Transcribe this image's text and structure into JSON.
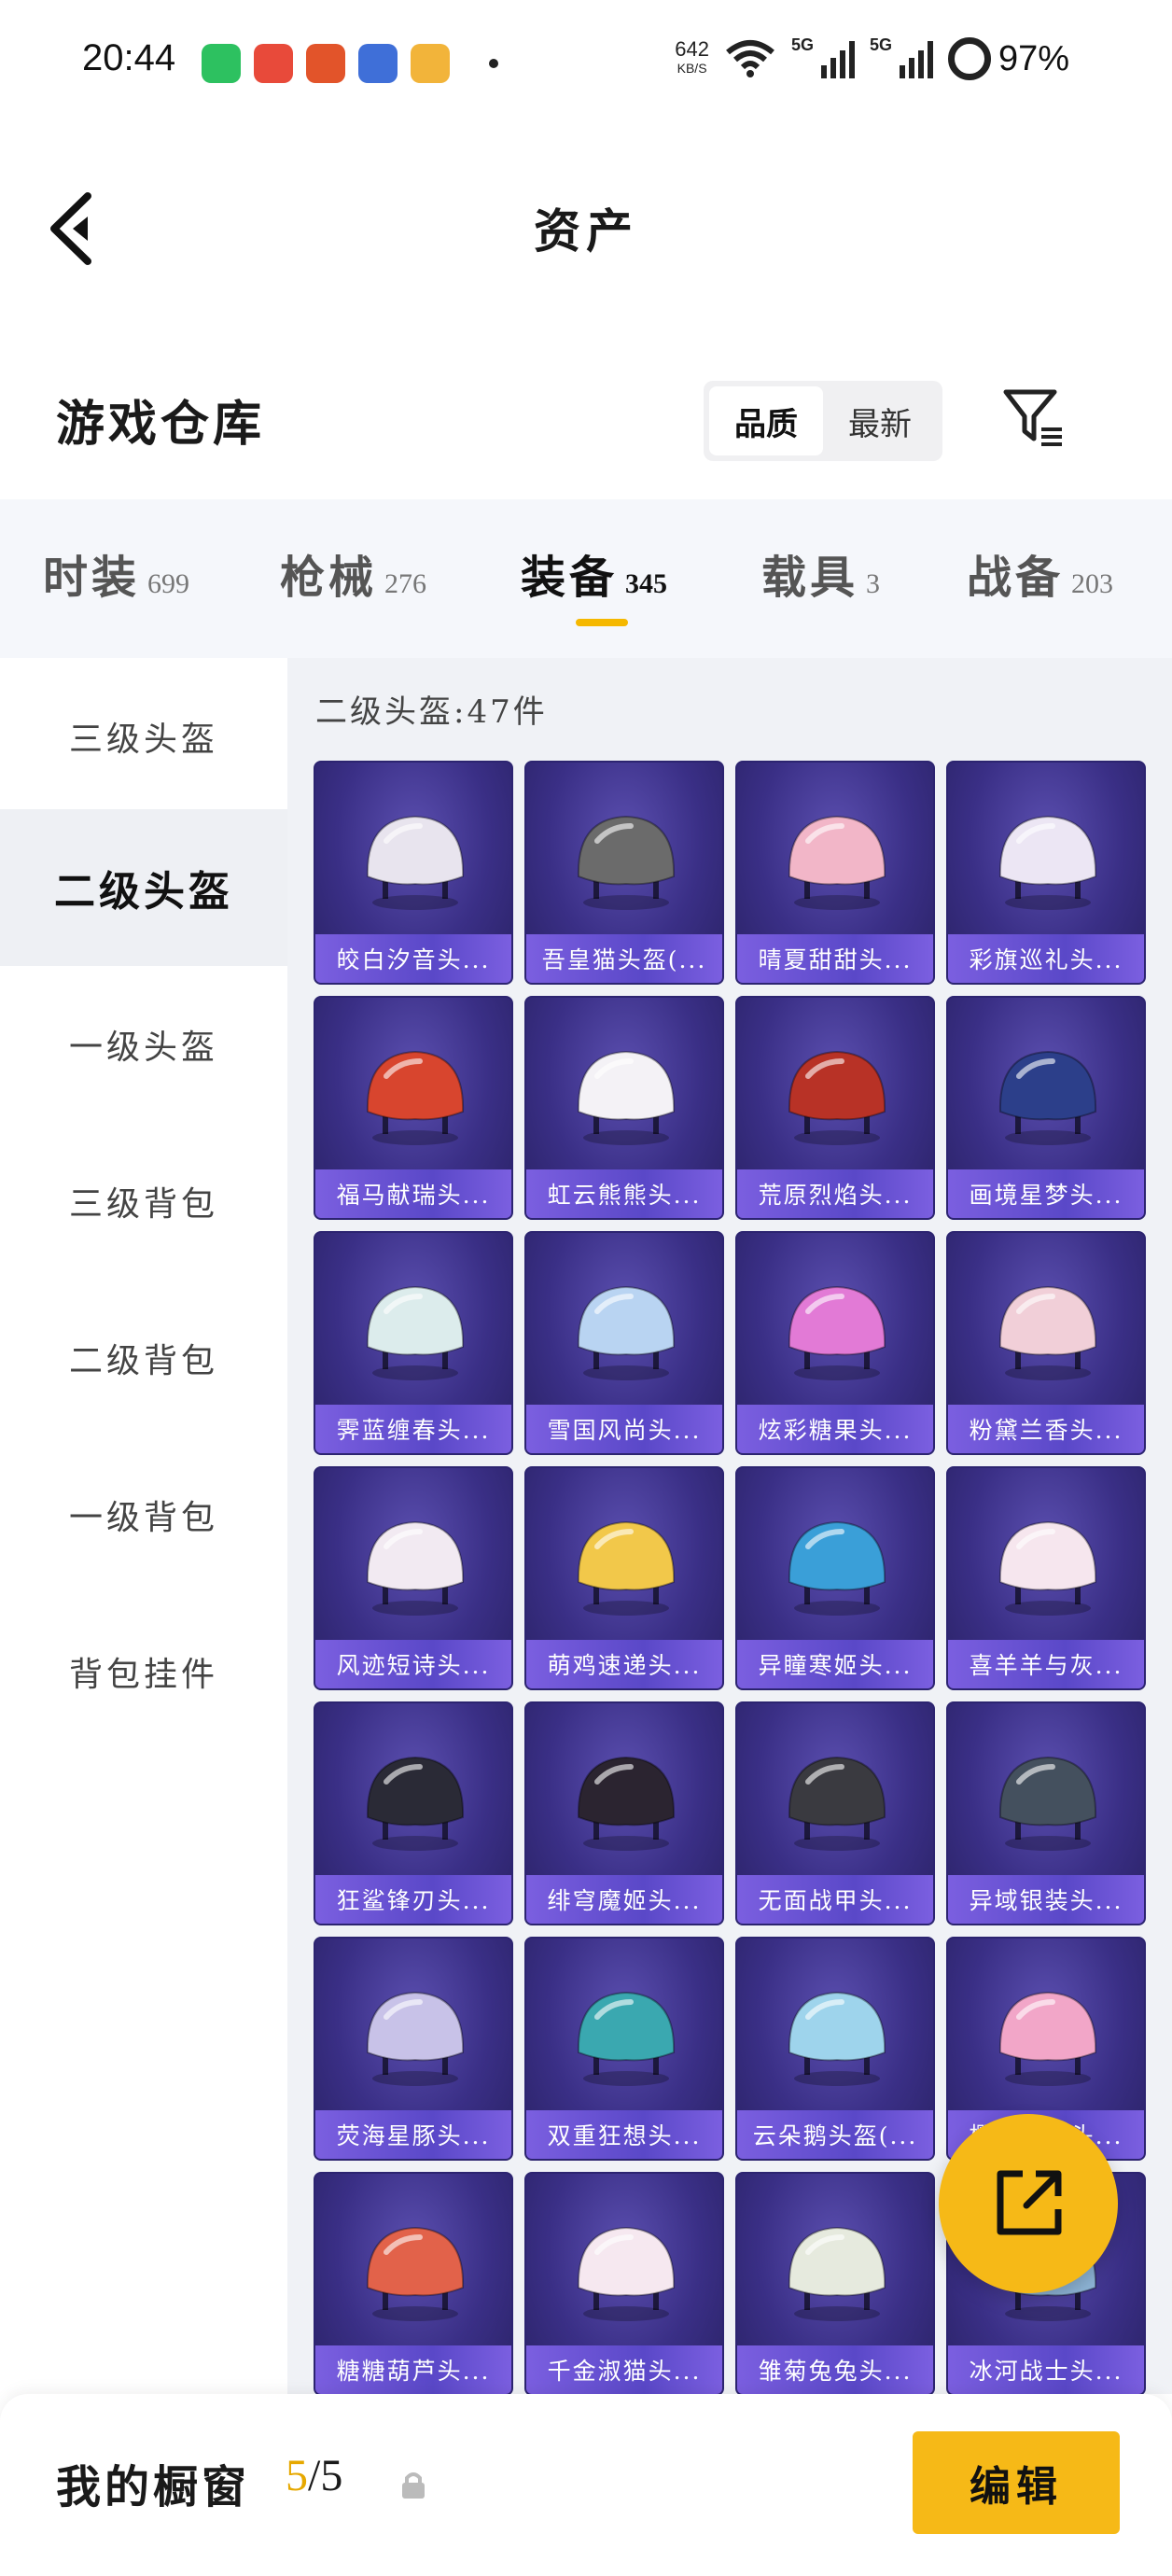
{
  "status_bar": {
    "time": "20:44",
    "net_speed": "642",
    "net_unit": "KB/S",
    "signal_1_label": "5G",
    "signal_2_label": "5G",
    "battery": "97%"
  },
  "header": {
    "title": "资产"
  },
  "warehouse": {
    "title": "游戏仓库",
    "sort_options": [
      "品质",
      "最新"
    ],
    "sort_selected": "品质"
  },
  "tabs": [
    {
      "name": "时装",
      "count": "699"
    },
    {
      "name": "枪械",
      "count": "276"
    },
    {
      "name": "装备",
      "count": "345"
    },
    {
      "name": "载具",
      "count": "3"
    },
    {
      "name": "战备",
      "count": "203"
    }
  ],
  "active_tab": "装备",
  "sidebar": {
    "items": [
      {
        "label": "三级头盔"
      },
      {
        "label": "二级头盔"
      },
      {
        "label": "一级头盔"
      },
      {
        "label": "三级背包"
      },
      {
        "label": "二级背包"
      },
      {
        "label": "一级背包"
      },
      {
        "label": "背包挂件"
      }
    ],
    "active": "二级头盔"
  },
  "content": {
    "count_label": "二级头盔:47件",
    "items": [
      {
        "name": "皎白汐音头...",
        "color": "#e8e4ee"
      },
      {
        "name": "吾皇猫头盔(...",
        "color": "#6b6b6b"
      },
      {
        "name": "晴夏甜甜头...",
        "color": "#f2b6c8"
      },
      {
        "name": "彩旗巡礼头...",
        "color": "#ece6f4"
      },
      {
        "name": "福马献瑞头...",
        "color": "#d8452e"
      },
      {
        "name": "虹云熊熊头...",
        "color": "#f4f2f6"
      },
      {
        "name": "荒原烈焰头...",
        "color": "#b83226"
      },
      {
        "name": "画境星梦头...",
        "color": "#2c3f8a"
      },
      {
        "name": "霁蓝缠春头...",
        "color": "#dcecec"
      },
      {
        "name": "雪国风尚头...",
        "color": "#b9d4f2"
      },
      {
        "name": "炫彩糖果头...",
        "color": "#e27ad6"
      },
      {
        "name": "粉黛兰香头...",
        "color": "#f1cfd8"
      },
      {
        "name": "风迹短诗头...",
        "color": "#f2eaf2"
      },
      {
        "name": "萌鸡速递头...",
        "color": "#f2c84a"
      },
      {
        "name": "异瞳寒姬头...",
        "color": "#3a9fd8"
      },
      {
        "name": "喜羊羊与灰...",
        "color": "#f6e6ee"
      },
      {
        "name": "狂鲨锋刃头...",
        "color": "#2a2a36"
      },
      {
        "name": "绯穹魔姬头...",
        "color": "#2b2430"
      },
      {
        "name": "无面战甲头...",
        "color": "#3a3a40"
      },
      {
        "name": "异域银装头...",
        "color": "#44505e"
      },
      {
        "name": "荧海星豚头...",
        "color": "#c8c2e8"
      },
      {
        "name": "双重狂想头...",
        "color": "#3aa8b0"
      },
      {
        "name": "云朵鹅头盔(...",
        "color": "#9ed4ec"
      },
      {
        "name": "樱粉兔兔头...",
        "color": "#f2a6c8"
      },
      {
        "name": "糖糖葫芦头...",
        "color": "#e2624a"
      },
      {
        "name": "千金淑猫头...",
        "color": "#f6e8f0"
      },
      {
        "name": "雏菊兔兔头...",
        "color": "#e6eade"
      },
      {
        "name": "冰河战士头...",
        "color": "#8fb6d8"
      }
    ]
  },
  "bottom_bar": {
    "label": "我的橱窗",
    "current": "5",
    "separator": "/",
    "total": "5",
    "edit_label": "编辑"
  },
  "colors": {
    "accent": "#f6b917",
    "card_bg": "#3a2f86",
    "card_label": "#6a52d4"
  }
}
